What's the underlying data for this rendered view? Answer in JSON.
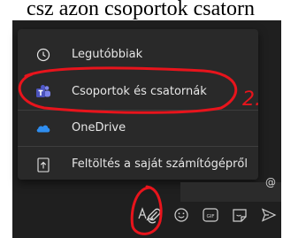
{
  "top_text": "csz azon csoportok csatorn",
  "menu": {
    "items": [
      {
        "label": "Legutóbbiak",
        "icon": "clock-icon"
      },
      {
        "label": "Csoportok és csatornák",
        "icon": "teams-icon"
      },
      {
        "label": "OneDrive",
        "icon": "onedrive-cloud-icon"
      },
      {
        "label": "Feltöltés a saját számítógépről",
        "icon": "upload-icon"
      }
    ]
  },
  "annotations": {
    "step_number": "2."
  },
  "compose": {
    "at_symbol": "@"
  },
  "toolbar": {
    "icons": [
      "format-icon",
      "attach-icon",
      "emoji-icon",
      "gif-icon",
      "sticker-icon",
      "send-icon"
    ],
    "gif_label": "GIF"
  },
  "colors": {
    "panel_bg": "#292929",
    "text": "#e6e6e6",
    "annotation": "#e8141c",
    "onedrive": "#2f8ef0",
    "teams": "#6264a7"
  }
}
